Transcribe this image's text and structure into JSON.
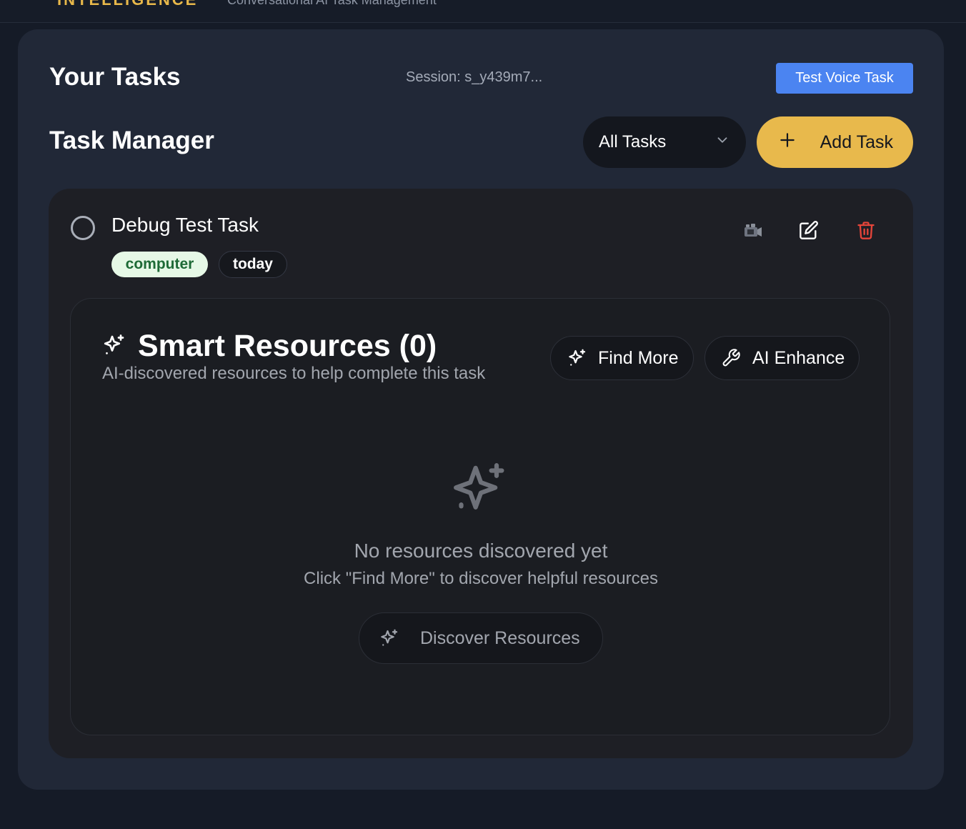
{
  "header": {
    "brand": "INTELLIGENCE",
    "subtitle": "Conversational AI Task Management"
  },
  "panel": {
    "title": "Your Tasks",
    "session": "Session: s_y439m7...",
    "voice_button": "Test Voice Task",
    "manager_title": "Task Manager",
    "filter": {
      "selected": "All Tasks"
    },
    "add_button": "Add Task"
  },
  "task": {
    "title": "Debug Test Task",
    "tags": [
      "computer",
      "today"
    ],
    "completed": false,
    "resources": {
      "title": "Smart Resources (0)",
      "subtitle": "AI-discovered resources to help complete this task",
      "find_more": "Find More",
      "ai_enhance": "AI Enhance",
      "empty_title": "No resources discovered yet",
      "empty_hint": "Click \"Find More\" to discover helpful resources",
      "discover_button": "Discover Resources"
    }
  },
  "icons": {
    "video": "video-camera-icon",
    "edit": "edit-icon",
    "delete": "trash-icon",
    "sparkles": "sparkles-icon",
    "wrench": "wrench-icon",
    "chevron": "chevron-down-icon",
    "plus": "plus-icon"
  },
  "colors": {
    "accent_yellow": "#e8b94c",
    "accent_blue": "#4b84f1",
    "danger": "#e5453a",
    "tag_green_bg": "#e6f8e6",
    "tag_green_text": "#1e6a36"
  }
}
